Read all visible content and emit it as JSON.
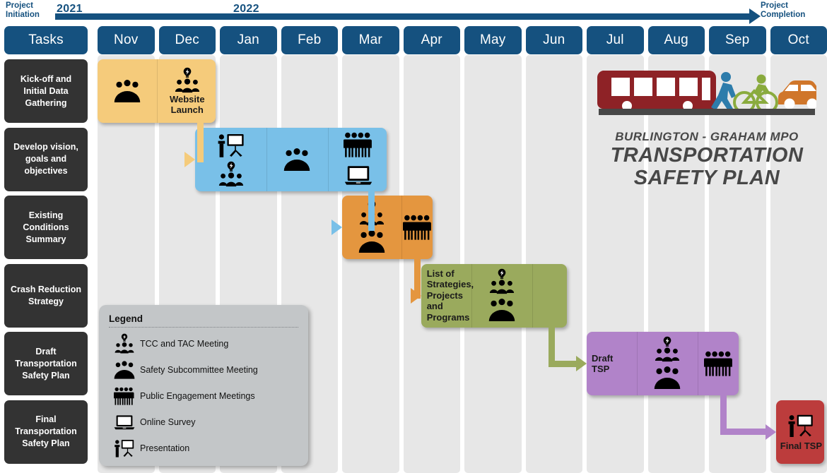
{
  "timeline": {
    "start_caption": "Project\nInitiation",
    "start_caption_l1": "Project",
    "start_caption_l2": "Initiation",
    "end_caption_l1": "Project",
    "end_caption_l2": "Completion",
    "year_left": "2021",
    "year_right": "2022"
  },
  "header": {
    "tasks_label": "Tasks",
    "months": [
      "Nov",
      "Dec",
      "Jan",
      "Feb",
      "Mar",
      "Apr",
      "May",
      "Jun",
      "Jul",
      "Aug",
      "Sep",
      "Oct"
    ]
  },
  "tasks": [
    {
      "label": "Kick-off and Initial Data Gathering"
    },
    {
      "label": "Develop vision, goals and objectives"
    },
    {
      "label": "Existing Conditions Summary"
    },
    {
      "label": "Crash Reduction Strategy"
    },
    {
      "label": "Draft Transportation Safety Plan"
    },
    {
      "label": "Final Transportation Safety Plan"
    }
  ],
  "bars": [
    {
      "id": "kickoff",
      "color": "#f5cb7b",
      "row": 0,
      "label": "",
      "segments": [
        {
          "icons": [
            "safety-subcommittee-icon"
          ],
          "label": ""
        },
        {
          "icons": [
            "tcc-tac-icon"
          ],
          "label": "Website Launch"
        }
      ]
    },
    {
      "id": "vision",
      "color": "#79c0e8",
      "row": 1,
      "label": "",
      "segments": [
        {
          "icons": [
            "presentation-icon",
            "tcc-tac-icon"
          ],
          "label": ""
        },
        {
          "icons": [
            "safety-subcommittee-icon"
          ],
          "label": ""
        },
        {
          "icons": [
            "public-engagement-icon",
            "online-survey-icon"
          ],
          "label": ""
        }
      ]
    },
    {
      "id": "existing",
      "color": "#e4963f",
      "row": 2,
      "label": "",
      "segments": [
        {
          "icons": [
            "tcc-tac-icon",
            "safety-subcommittee-icon"
          ],
          "label": ""
        },
        {
          "icons": [
            "public-engagement-icon"
          ],
          "label": ""
        }
      ]
    },
    {
      "id": "crash",
      "color": "#9aaa5d",
      "row": 3,
      "label": "List of Strategies, Projects and Programs",
      "segments": [
        {
          "icons": [],
          "label": "List of Strategies, Projects and Programs"
        },
        {
          "icons": [
            "tcc-tac-icon",
            "safety-subcommittee-icon"
          ],
          "label": ""
        },
        {
          "icons": [],
          "label": ""
        }
      ]
    },
    {
      "id": "draft-tsp",
      "color": "#b183c9",
      "row": 4,
      "label": "Draft TSP",
      "segments": [
        {
          "icons": [],
          "label": "Draft TSP"
        },
        {
          "icons": [
            "tcc-tac-icon",
            "safety-subcommittee-icon"
          ],
          "label": ""
        },
        {
          "icons": [
            "public-engagement-icon"
          ],
          "label": ""
        }
      ]
    },
    {
      "id": "final-tsp",
      "color": "#bc3c3c",
      "row": 5,
      "label": "Final TSP",
      "segments": [
        {
          "icons": [
            "presentation-icon"
          ],
          "label": "Final TSP"
        }
      ]
    }
  ],
  "legend": {
    "title": "Legend",
    "items": [
      {
        "icon": "tcc-tac-icon",
        "label": "TCC and TAC Meeting"
      },
      {
        "icon": "safety-subcommittee-icon",
        "label": "Safety Subcommittee Meeting"
      },
      {
        "icon": "public-engagement-icon",
        "label": "Public Engagement Meetings"
      },
      {
        "icon": "online-survey-icon",
        "label": "Online Survey"
      },
      {
        "icon": "presentation-icon",
        "label": "Presentation"
      }
    ]
  },
  "logo": {
    "org": "BURLINGTON - GRAHAM MPO",
    "line1": "TRANSPORTATION",
    "line2": "SAFETY PLAN",
    "colors": {
      "bus": "#8e2226",
      "pedestrian": "#2d7cab",
      "bicycle": "#8aab3e",
      "car": "#d0762a",
      "road": "#474747",
      "text": "#474747"
    }
  },
  "colors": {
    "header_blue": "#15517f",
    "task_dark": "#333333",
    "stripe": "#e7e7e7",
    "legend_bg": "#c3c6c8"
  }
}
